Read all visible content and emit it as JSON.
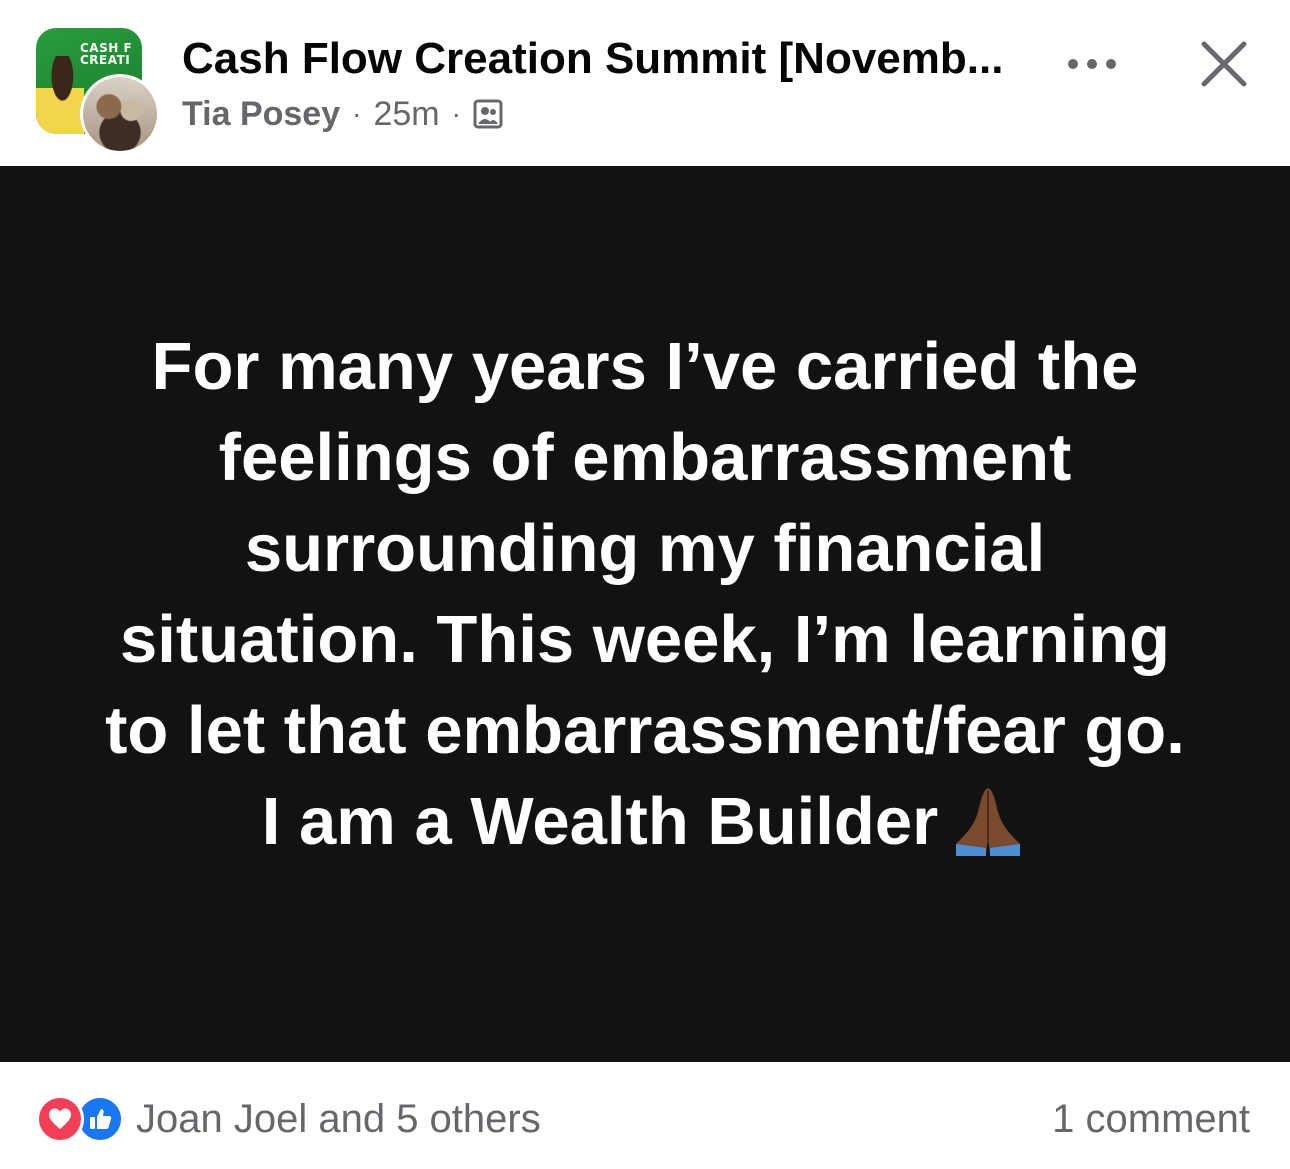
{
  "header": {
    "group_avatar_text": "CASH F\nCREATI",
    "title": "Cash Flow Creation Summit [Novemb...",
    "author": "Tia Posey",
    "separator": "·",
    "time_ago": "25m",
    "audience_icon": "group-audience-icon",
    "more_icon": "more-dots-icon",
    "close_icon": "close-icon"
  },
  "post": {
    "background_color": "#121212",
    "text": "For many years I’ve carried the feelings of embarrassment surrounding my financial situation. This week, I’m learning to let that embarrassment/fear go. I am a Wealth Builder",
    "emoji_icon": "folded-hands-emoji"
  },
  "footer": {
    "reaction_icons": [
      "love-reaction-icon",
      "like-reaction-icon"
    ],
    "reactions_text": "Joan Joel and 5 others",
    "comments_text": "1 comment"
  },
  "colors": {
    "love": "#f33e58",
    "like": "#1877f2",
    "secondary_text": "#65676b",
    "primary_text": "#050505"
  }
}
